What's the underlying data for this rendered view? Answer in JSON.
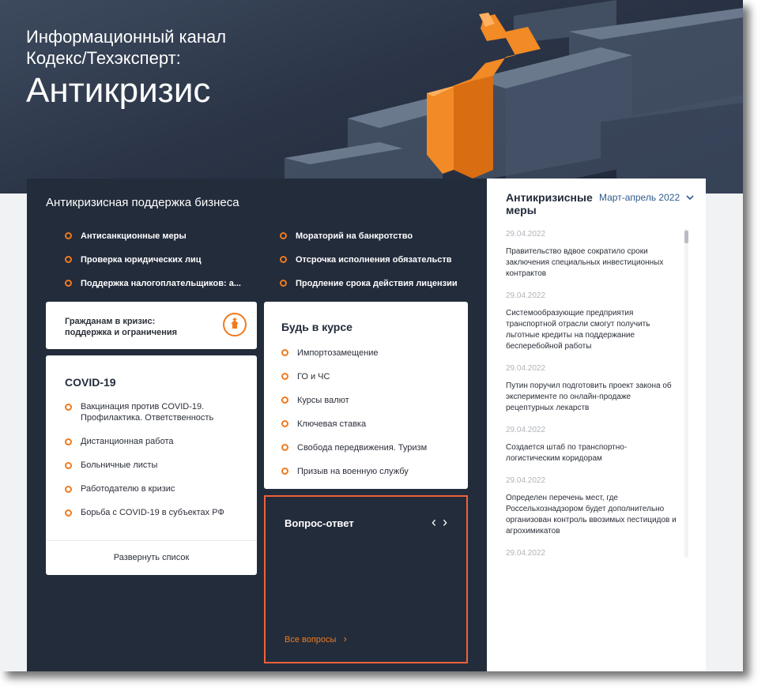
{
  "hero": {
    "line1": "Информационный канал",
    "line2": "Кодекс/Техэксперт:",
    "title": "Антикризис"
  },
  "business": {
    "title": "Антикризисная поддержка бизнеса",
    "links_left": [
      "Антисанкционные меры",
      "Проверка юридических лиц",
      "Поддержка налогоплательщиков: а..."
    ],
    "links_right": [
      "Мораторий на банкротство",
      "Отсрочка исполнения обязательств",
      "Продление срока действия лицензии"
    ]
  },
  "citizens": {
    "line1": "Гражданам в кризис:",
    "line2": "поддержка и ограничения",
    "icon": "house-up-arrow-icon"
  },
  "covid": {
    "title": "COVID-19",
    "items": [
      "Вакцинация против COVID-19. Профилактика. Ответственность",
      "Дистанционная работа",
      "Больничные листы",
      "Работодателю в кризис",
      "Борьба с COVID-19 в субъектах РФ"
    ],
    "expand_label": "Развернуть список"
  },
  "course": {
    "title": "Будь в курсе",
    "items": [
      "Импортозамещение",
      "ГО и ЧС",
      "Курсы валют",
      "Ключевая ставка",
      "Свобода передвижения. Туризм",
      "Призыв на военную службу"
    ]
  },
  "qa": {
    "title": "Вопрос-ответ",
    "prev": "‹",
    "next": "›",
    "all_label": "Все вопросы",
    "all_arrow": "›"
  },
  "measures": {
    "title": "Антикризисные меры",
    "period": "Март-апрель 2022",
    "period_icon": "chevron-down-icon",
    "feed": [
      {
        "date": "29.04.2022",
        "text": "Правительство вдвое сократило сроки заключения специальных инвестиционных контрактов"
      },
      {
        "date": "29.04.2022",
        "text": "Системообразующие предприятия транспортной отрасли смогут получить льготные кредиты на поддержание бесперебойной работы"
      },
      {
        "date": "29.04.2022",
        "text": "Путин поручил подготовить проект закона об эксперименте по онлайн-продаже рецептурных лекарств"
      },
      {
        "date": "29.04.2022",
        "text": "Создается штаб по транспортно-логистическим коридорам"
      },
      {
        "date": "29.04.2022",
        "text": "Определен перечень мест, где Россельхознадзором будет дополнительно организован контроль ввозимых пестицидов и агрохимикатов"
      },
      {
        "date": "29.04.2022",
        "text": ""
      }
    ]
  },
  "colors": {
    "accent": "#f07a1e",
    "panel": "#232c3b",
    "qa_border": "#f0613a",
    "link_blue": "#2f5b8c"
  }
}
